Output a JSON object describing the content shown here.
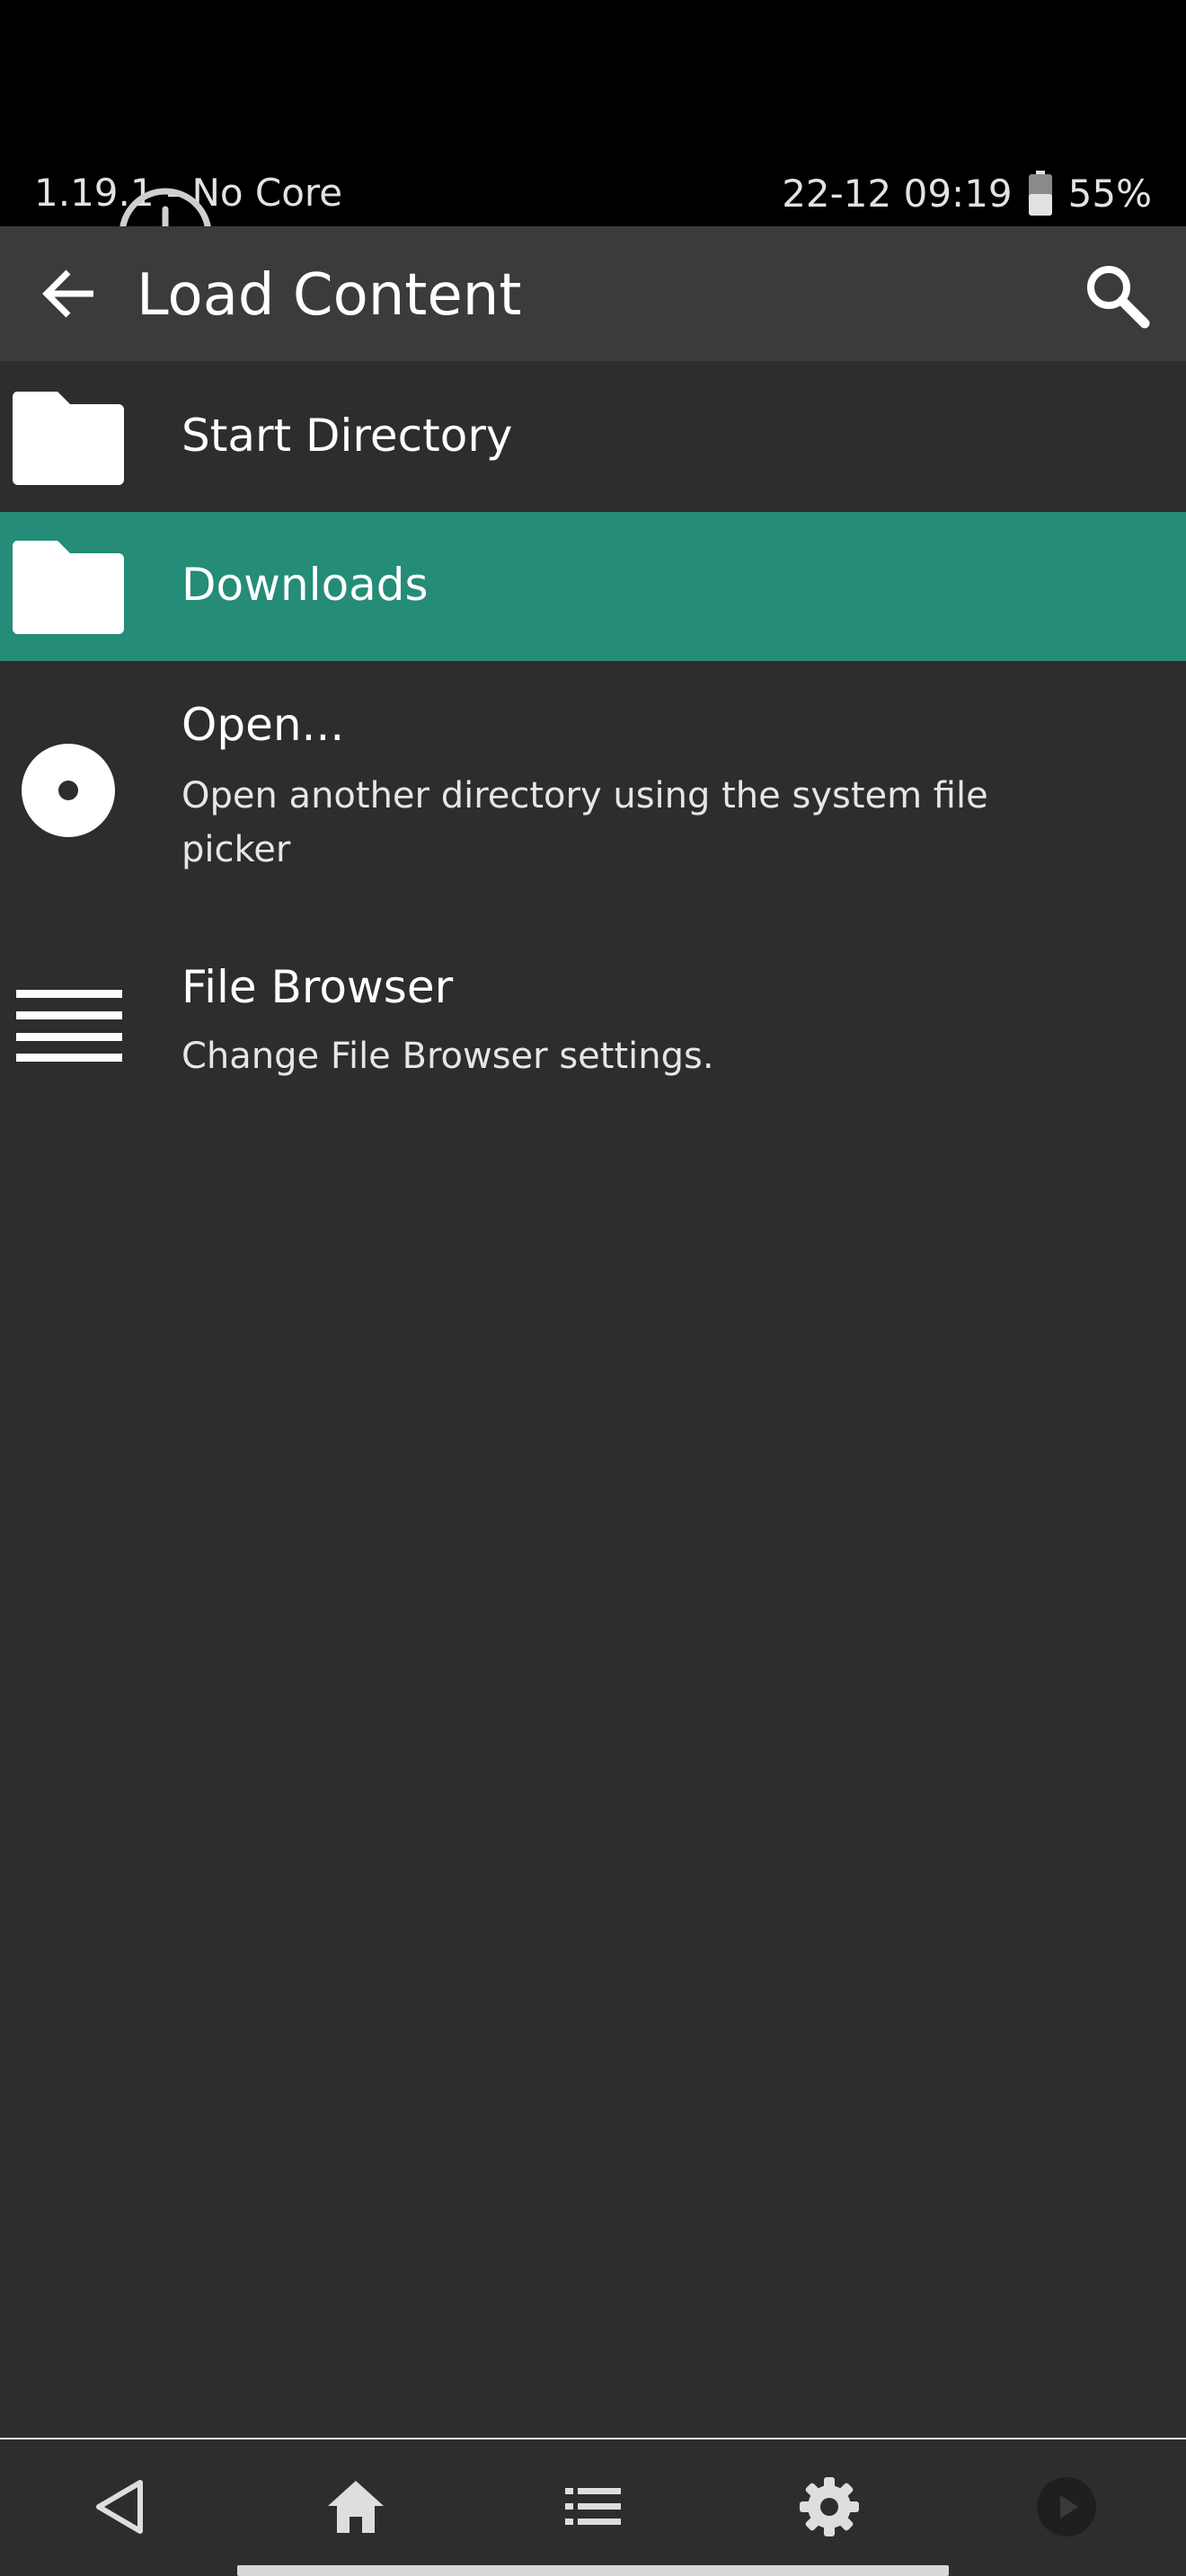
{
  "status_bar": {
    "left_text": "1.19.1 - No Core",
    "datetime": "22-12 09:19",
    "battery": "55%"
  },
  "app_bar": {
    "title": "Load Content"
  },
  "menu_items": [
    {
      "label": "Start Directory"
    },
    {
      "label": "Downloads"
    },
    {
      "label": "Open...",
      "sublabel": "Open another directory using the system file picker"
    },
    {
      "label": "File Browser",
      "sublabel": "Change File Browser settings."
    }
  ],
  "colors": {
    "background": "#2d2d2d",
    "app_bar": "#3b3b3b",
    "selected": "#258c77"
  },
  "icons": [
    "download-icon",
    "back-arrow-icon",
    "search-icon",
    "folder-icon",
    "disc-icon",
    "list-icon",
    "nav-back-icon",
    "home-icon",
    "playlist-icon",
    "settings-icon",
    "play-icon"
  ]
}
